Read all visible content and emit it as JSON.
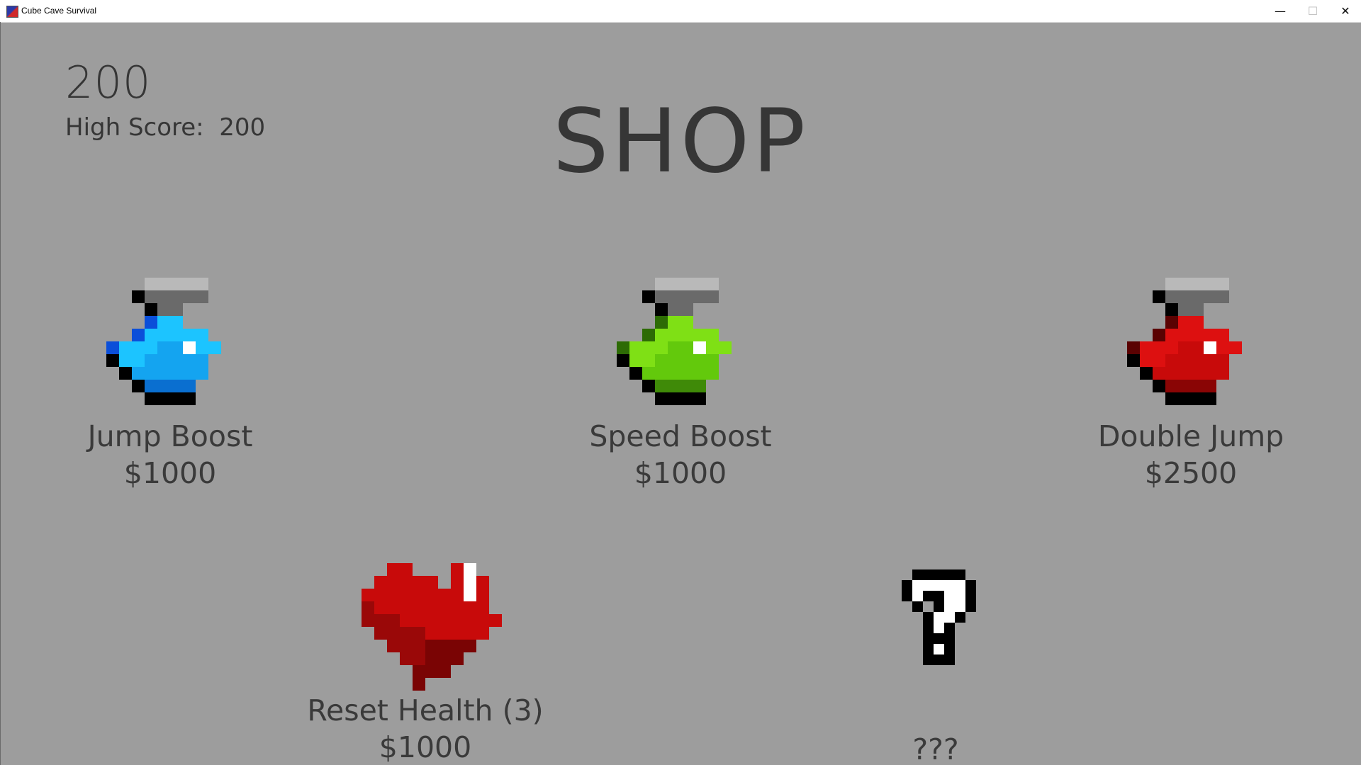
{
  "window": {
    "title": "Cube Cave Survival",
    "minimize_glyph": "—",
    "maximize_glyph": "☐",
    "close_glyph": "✕"
  },
  "hud": {
    "score": "200",
    "high_score_text": "High Score:  200"
  },
  "shop": {
    "title": "SHOP",
    "items": [
      {
        "label": "Jump Boost",
        "price": "$1000",
        "icon": "blue-potion-icon",
        "color": "#14a4f0"
      },
      {
        "label": "Speed Boost",
        "price": "$1000",
        "icon": "green-potion-icon",
        "color": "#63c90c"
      },
      {
        "label": "Double Jump",
        "price": "$2500",
        "icon": "red-potion-icon",
        "color": "#c80a0a"
      },
      {
        "label": "Reset Health (3)",
        "price": "$1000",
        "icon": "heart-icon",
        "color": "#c80a0a"
      },
      {
        "label": "???",
        "price": "",
        "icon": "question-mark-icon",
        "color": "#ffffff"
      }
    ]
  }
}
